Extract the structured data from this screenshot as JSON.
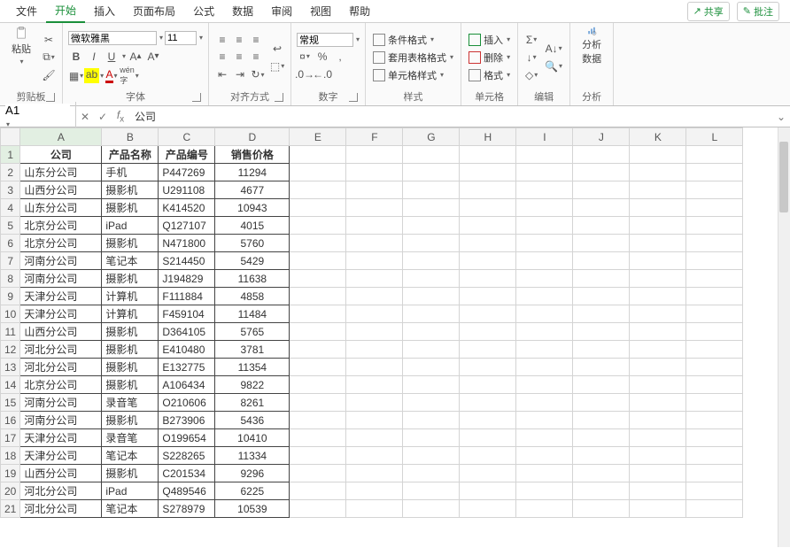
{
  "tabs": {
    "file": "文件",
    "home": "开始",
    "insert": "插入",
    "layout": "页面布局",
    "formula": "公式",
    "data": "数据",
    "review": "审阅",
    "view": "视图",
    "help": "帮助"
  },
  "topRight": {
    "share": "共享",
    "comment": "批注"
  },
  "ribbon": {
    "clipboard": {
      "label": "剪贴板",
      "paste": "粘贴"
    },
    "font": {
      "label": "字体",
      "name": "微软雅黑",
      "size": "11",
      "bold": "B",
      "italic": "I",
      "underline": "U"
    },
    "align": {
      "label": "对齐方式"
    },
    "number": {
      "label": "数字",
      "format": "常规"
    },
    "styles": {
      "label": "样式",
      "cond": "条件格式",
      "tbl": "套用表格格式",
      "cell": "单元格样式"
    },
    "cells": {
      "label": "单元格",
      "insert": "插入",
      "delete": "删除",
      "format": "格式"
    },
    "edit": {
      "label": "编辑"
    },
    "analyze": {
      "label": "分析",
      "btn": "分析\n数据"
    }
  },
  "formulaBar": {
    "ref": "A1",
    "value": "公司"
  },
  "headers": [
    "A",
    "B",
    "C",
    "D",
    "E",
    "F",
    "G",
    "H",
    "I",
    "J",
    "K",
    "L"
  ],
  "tableHead": [
    "公司",
    "产品名称",
    "产品编号",
    "销售价格"
  ],
  "rows": [
    [
      "山东分公司",
      "手机",
      "P447269",
      "11294"
    ],
    [
      "山西分公司",
      "摄影机",
      "U291108",
      "4677"
    ],
    [
      "山东分公司",
      "摄影机",
      "K414520",
      "10943"
    ],
    [
      "北京分公司",
      "iPad",
      "Q127107",
      "4015"
    ],
    [
      "北京分公司",
      "摄影机",
      "N471800",
      "5760"
    ],
    [
      "河南分公司",
      "笔记本",
      "S214450",
      "5429"
    ],
    [
      "河南分公司",
      "摄影机",
      "J194829",
      "11638"
    ],
    [
      "天津分公司",
      "计算机",
      "F111884",
      "4858"
    ],
    [
      "天津分公司",
      "计算机",
      "F459104",
      "11484"
    ],
    [
      "山西分公司",
      "摄影机",
      "D364105",
      "5765"
    ],
    [
      "河北分公司",
      "摄影机",
      "E410480",
      "3781"
    ],
    [
      "河北分公司",
      "摄影机",
      "E132775",
      "11354"
    ],
    [
      "北京分公司",
      "摄影机",
      "A106434",
      "9822"
    ],
    [
      "河南分公司",
      "录音笔",
      "O210606",
      "8261"
    ],
    [
      "河南分公司",
      "摄影机",
      "B273906",
      "5436"
    ],
    [
      "天津分公司",
      "录音笔",
      "O199654",
      "10410"
    ],
    [
      "天津分公司",
      "笔记本",
      "S228265",
      "11334"
    ],
    [
      "山西分公司",
      "摄影机",
      "C201534",
      "9296"
    ],
    [
      "河北分公司",
      "iPad",
      "Q489546",
      "6225"
    ],
    [
      "河北分公司",
      "笔记本",
      "S278979",
      "10539"
    ]
  ],
  "colors": {
    "accent": "#1a8f3a"
  }
}
